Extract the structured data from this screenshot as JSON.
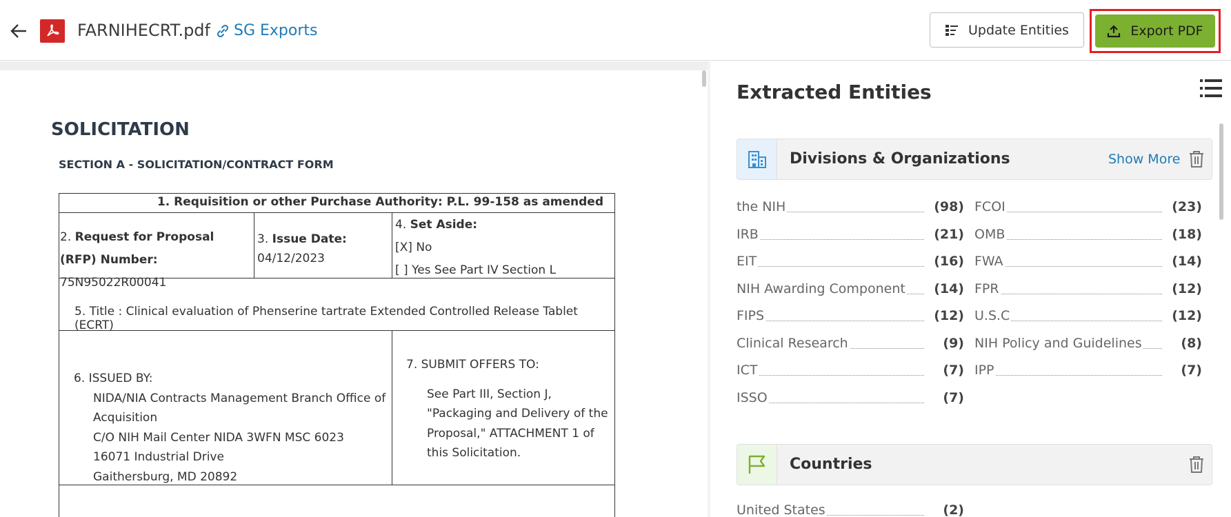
{
  "header": {
    "filename": "FARNIHECRT.pdf",
    "link_label": "SG Exports",
    "update_label": "Update Entities",
    "export_label": "Export PDF"
  },
  "document": {
    "title": "SOLICITATION",
    "section": "SECTION A - SOLICITATION/CONTRACT FORM",
    "row1": "1. Requisition or other Purchase Authority: P.L. 99-158 as amended",
    "cell2_prefix": "2. ",
    "cell2_bold1": "Request for Proposal",
    "cell2_bold2": "(RFP) Number:",
    "cell2_value": " 75N95022R00041",
    "cell3_prefix": "3. ",
    "cell3_bold": "Issue Date:",
    "cell3_value": "04/12/2023",
    "cell4_prefix": "4. ",
    "cell4_bold": "Set Aside:",
    "cell4_line1": "[X] No",
    "cell4_line2": "[ ] Yes See Part IV Section L",
    "row3": "5. Title : Clinical evaluation of Phenserine tartrate Extended Controlled Release Tablet (ECRT)",
    "issued_by_label": "6. ISSUED BY:",
    "issued_lines": [
      "NIDA/NIA Contracts Management Branch Office of",
      "Acquisition",
      "C/O NIH Mail Center NIDA 3WFN MSC 6023",
      "16071 Industrial Drive",
      "Gaithersburg, MD 20892"
    ],
    "submit_label": "7. SUBMIT OFFERS TO:",
    "submit_lines": [
      "See Part III, Section J,",
      "\"Packaging and Delivery of the",
      "Proposal,\" ATTACHMENT 1 of",
      "this Solicitation."
    ]
  },
  "entities": {
    "title": "Extracted Entities",
    "categories": [
      {
        "label": "Divisions & Organizations",
        "show_more": "Show More",
        "items": [
          {
            "name": "the NIH",
            "count": "(98)"
          },
          {
            "name": "FCOI",
            "count": "(23)"
          },
          {
            "name": "IRB",
            "count": "(21)"
          },
          {
            "name": "OMB",
            "count": "(18)"
          },
          {
            "name": "EIT",
            "count": "(16)"
          },
          {
            "name": "FWA",
            "count": "(14)"
          },
          {
            "name": "NIH Awarding Component",
            "count": "(14)"
          },
          {
            "name": "FPR",
            "count": "(12)"
          },
          {
            "name": "FIPS",
            "count": "(12)"
          },
          {
            "name": "U.S.C",
            "count": "(12)"
          },
          {
            "name": "Clinical Research",
            "count": "(9)"
          },
          {
            "name": "NIH Policy and Guidelines",
            "count": "(8)"
          },
          {
            "name": "ICT",
            "count": "(7)"
          },
          {
            "name": "IPP",
            "count": "(7)"
          },
          {
            "name": "ISSO",
            "count": "(7)"
          }
        ]
      },
      {
        "label": "Countries",
        "items": [
          {
            "name": "United States",
            "count": "(2)"
          }
        ]
      }
    ]
  },
  "colors": {
    "accent": "#7cb030",
    "link": "#1f7ab8",
    "pdf": "#d32828",
    "highlight": "#e02020"
  }
}
